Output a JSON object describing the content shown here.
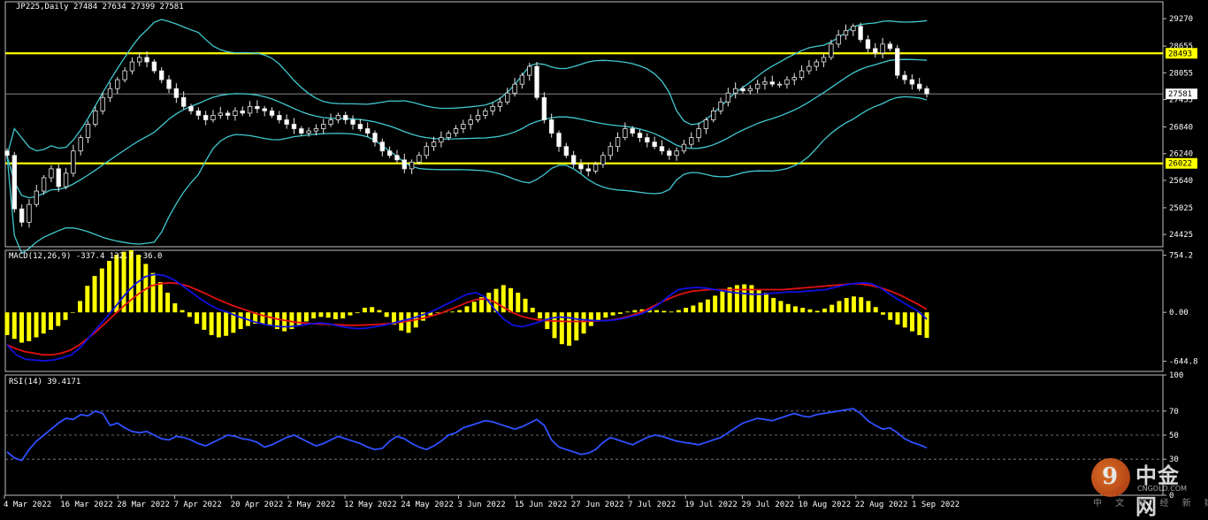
{
  "chart_data": [
    {
      "type": "candlestick",
      "panel": "price",
      "header": "JP225,Daily  27484 27634 27399 27581",
      "ylim": [
        24150,
        29650
      ],
      "yticks": [
        "29270",
        "28655",
        "28055",
        "27455",
        "26840",
        "26240",
        "25640",
        "25025",
        "24425"
      ],
      "ytick_values": [
        29270,
        28655,
        28055,
        27455,
        26840,
        26240,
        25640,
        25025,
        24425
      ],
      "badges": [
        {
          "label": "28493",
          "value": 28493,
          "color": "#ffff00"
        },
        {
          "label": "27581",
          "value": 27581,
          "color": "#ffffff"
        },
        {
          "label": "26022",
          "value": 26022,
          "color": "#ffff00"
        }
      ],
      "hlines": [
        {
          "name": "resistance",
          "value": 28493,
          "color": "#ffff00"
        },
        {
          "name": "support",
          "value": 26022,
          "color": "#ffff00"
        },
        {
          "name": "last-price",
          "value": 27581,
          "color": "#9a9a9a"
        }
      ],
      "close": [
        26200,
        25000,
        24700,
        25100,
        25400,
        25700,
        25900,
        25500,
        25800,
        26300,
        26600,
        26900,
        27200,
        27500,
        27700,
        27900,
        28100,
        28300,
        28400,
        28300,
        28100,
        27900,
        27700,
        27500,
        27300,
        27200,
        27100,
        27000,
        27100,
        27150,
        27100,
        27200,
        27150,
        27300,
        27250,
        27200,
        27100,
        27000,
        26900,
        26800,
        26700,
        26750,
        26800,
        26900,
        27000,
        27100,
        27000,
        26900,
        26800,
        26700,
        26500,
        26300,
        26200,
        26100,
        25900,
        26050,
        26200,
        26400,
        26500,
        26600,
        26700,
        26800,
        26900,
        27000,
        27100,
        27200,
        27300,
        27400,
        27600,
        27800,
        28000,
        28200,
        27500,
        27000,
        26700,
        26400,
        26200,
        26000,
        25900,
        25850,
        26000,
        26200,
        26400,
        26600,
        26800,
        26700,
        26600,
        26500,
        26400,
        26300,
        26200,
        26300,
        26450,
        26600,
        26800,
        27000,
        27200,
        27400,
        27600,
        27700,
        27650,
        27700,
        27800,
        27850,
        27800,
        27800,
        27900,
        27950,
        28100,
        28200,
        28300,
        28400,
        28700,
        28900,
        29000,
        29100,
        28800,
        28600,
        28500,
        28700,
        28600,
        28000,
        27900,
        27800,
        27700,
        27581
      ],
      "bollinger_color": "#40c8d0",
      "bollinger_period": 20,
      "bollinger_k": 2
    },
    {
      "type": "macd",
      "panel": "macd",
      "header": "MACD(12,26,9) -337.4 132.7 -36.0",
      "ylim": [
        -780,
        820
      ],
      "yticks": [
        "754.2",
        "0.00",
        "-644.8"
      ],
      "ytick_values": [
        754.2,
        0,
        -644.8
      ],
      "histogram_color": "#ffff00",
      "macd_line_color": "#1010e0",
      "signal_line_color": "#e01010",
      "histogram": [
        -300,
        -350,
        -400,
        -380,
        -330,
        -280,
        -230,
        -180,
        -100,
        0,
        150,
        350,
        480,
        580,
        680,
        760,
        800,
        820,
        760,
        640,
        520,
        400,
        260,
        120,
        30,
        -60,
        -150,
        -230,
        -300,
        -330,
        -310,
        -270,
        -220,
        -180,
        -150,
        -150,
        -180,
        -220,
        -250,
        -220,
        -170,
        -120,
        -80,
        -60,
        -70,
        -90,
        -80,
        -40,
        -10,
        60,
        70,
        30,
        -60,
        -160,
        -240,
        -270,
        -200,
        -110,
        -40,
        0,
        10,
        10,
        30,
        80,
        140,
        200,
        260,
        310,
        360,
        320,
        260,
        180,
        60,
        -80,
        -220,
        -340,
        -420,
        -440,
        -370,
        -280,
        -180,
        -110,
        -70,
        -40,
        -20,
        10,
        30,
        40,
        40,
        30,
        20,
        10,
        30,
        60,
        90,
        130,
        170,
        220,
        280,
        330,
        360,
        370,
        360,
        300,
        260,
        190,
        150,
        110,
        80,
        60,
        40,
        20,
        50,
        100,
        150,
        190,
        210,
        200,
        150,
        70,
        -30,
        -100,
        -160,
        -200,
        -250,
        -300,
        -337
      ],
      "macd": [
        -430,
        -560,
        -620,
        -630,
        -640,
        -630,
        -600,
        -560,
        -460,
        -320,
        -180,
        -40,
        110,
        260,
        380,
        470,
        500,
        490,
        440,
        360,
        270,
        180,
        100,
        40,
        0,
        -50,
        -90,
        -130,
        -160,
        -180,
        -190,
        -185,
        -170,
        -150,
        -140,
        -150,
        -180,
        -200,
        -215,
        -210,
        -190,
        -170,
        -140,
        -110,
        -80,
        -40,
        0,
        60,
        120,
        180,
        240,
        260,
        200,
        40,
        -90,
        -170,
        -190,
        -160,
        -120,
        -80,
        -60,
        -70,
        -90,
        -100,
        -110,
        -110,
        -100,
        -80,
        -50,
        -20,
        40,
        120,
        220,
        300,
        320,
        330,
        320,
        300,
        280,
        260,
        250,
        240,
        240,
        250,
        260,
        270,
        270,
        280,
        290,
        300,
        330,
        360,
        380,
        390,
        380,
        320,
        240,
        160,
        90,
        20,
        -90
      ],
      "signal": [
        -430,
        -480,
        -520,
        -540,
        -560,
        -560,
        -540,
        -500,
        -430,
        -340,
        -240,
        -130,
        -20,
        90,
        190,
        280,
        350,
        380,
        390,
        380,
        350,
        300,
        250,
        190,
        140,
        90,
        50,
        10,
        -30,
        -60,
        -90,
        -110,
        -130,
        -140,
        -150,
        -155,
        -160,
        -165,
        -170,
        -170,
        -165,
        -160,
        -150,
        -140,
        -125,
        -105,
        -80,
        -50,
        -15,
        30,
        80,
        130,
        170,
        180,
        140,
        70,
        0,
        -50,
        -80,
        -100,
        -110,
        -115,
        -120,
        -120,
        -120,
        -115,
        -110,
        -100,
        -80,
        -50,
        -10,
        40,
        100,
        160,
        210,
        250,
        280,
        290,
        300,
        300,
        300,
        300,
        300,
        300,
        300,
        300,
        300,
        310,
        320,
        330,
        340,
        350,
        360,
        370,
        380,
        370,
        350,
        320,
        280,
        230,
        170,
        110,
        40
      ]
    },
    {
      "type": "line",
      "panel": "rsi",
      "header": "RSI(14) 39.4171",
      "ylim": [
        0,
        100
      ],
      "yticks": [
        "100",
        "70",
        "50",
        "30",
        "0"
      ],
      "ytick_values": [
        100,
        70,
        50,
        30,
        0
      ],
      "levels": [
        70,
        50,
        30
      ],
      "line_color": "#3050ff",
      "values": [
        36,
        31,
        29,
        38,
        45,
        50,
        55,
        60,
        64,
        63,
        67,
        66,
        70,
        68,
        58,
        60,
        56,
        53,
        52,
        53,
        50,
        47,
        46,
        49,
        48,
        46,
        43,
        41,
        44,
        47,
        50,
        49,
        47,
        46,
        44,
        40,
        42,
        45,
        48,
        50,
        47,
        44,
        41,
        43,
        46,
        49,
        47,
        45,
        43,
        40,
        38,
        39,
        45,
        49,
        47,
        43,
        40,
        38,
        41,
        45,
        50,
        52,
        56,
        58,
        60,
        62,
        61,
        59,
        57,
        55,
        57,
        60,
        63,
        58,
        46,
        40,
        38,
        36,
        34,
        35,
        38,
        44,
        48,
        46,
        44,
        42,
        45,
        48,
        50,
        49,
        47,
        45,
        44,
        43,
        42,
        44,
        46,
        48,
        52,
        56,
        60,
        62,
        64,
        63,
        62,
        64,
        66,
        68,
        66,
        65,
        67,
        68,
        69,
        70,
        71,
        72,
        68,
        62,
        58,
        55,
        56,
        52,
        47,
        44,
        42,
        39.4
      ]
    }
  ],
  "dates": [
    "4 Mar 2022",
    "16 Mar 2022",
    "28 Mar 2022",
    "7 Apr 2022",
    "20 Apr 2022",
    "2 May 2022",
    "12 May 2022",
    "24 May 2022",
    "3 Jun 2022",
    "15 Jun 2022",
    "27 Jun 2022",
    "7 Jul 2022",
    "19 Jul 2022",
    "29 Jul 2022",
    "10 Aug 2022",
    "22 Aug 2022",
    "1 Sep 2022"
  ],
  "watermark": {
    "brand": "中金网",
    "domain": "CNGOLD.COM",
    "tagline": "中 文 财 经 新 媒 体",
    "mark": "9"
  }
}
